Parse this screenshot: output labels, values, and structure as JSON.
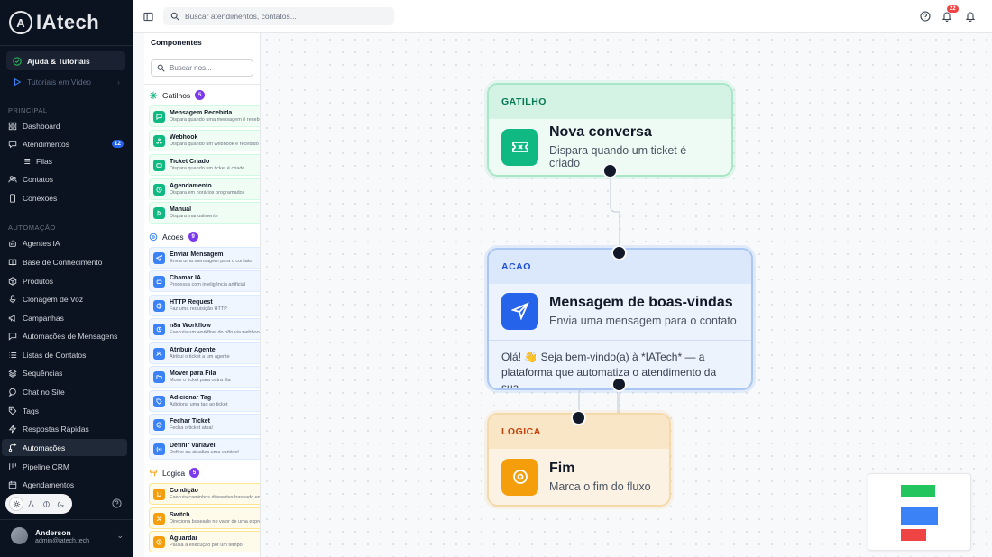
{
  "brand": {
    "logo_text": "IAtech",
    "logo_mark": "A"
  },
  "sidebar": {
    "help": {
      "label": "Ajuda & Tutoriais",
      "icon": "check-circle-icon"
    },
    "videos": {
      "label": "Tutoriais em Vídeo",
      "icon": "play-icon"
    },
    "sections": {
      "principal": "PRINCIPAL",
      "automacao": "AUTOMAÇÃO"
    },
    "items": [
      {
        "label": "Dashboard",
        "icon": "grid-icon"
      },
      {
        "label": "Atendimentos",
        "icon": "chat-icon",
        "badge": "12"
      },
      {
        "label": "Filas",
        "icon": "list-icon"
      },
      {
        "label": "Contatos",
        "icon": "users-icon"
      },
      {
        "label": "Conexões",
        "icon": "phone-icon"
      },
      {
        "label": "Agentes IA",
        "icon": "bot-icon"
      },
      {
        "label": "Base de Conhecimento",
        "icon": "book-icon"
      },
      {
        "label": "Produtos",
        "icon": "box-icon"
      },
      {
        "label": "Clonagem de Voz",
        "icon": "mic-icon"
      },
      {
        "label": "Campanhas",
        "icon": "megaphone-icon"
      },
      {
        "label": "Automações de Mensagens",
        "icon": "message-icon"
      },
      {
        "label": "Listas de Contatos",
        "icon": "list-icon"
      },
      {
        "label": "Sequências",
        "icon": "layers-icon"
      },
      {
        "label": "Chat no Site",
        "icon": "chat-icon"
      },
      {
        "label": "Tags",
        "icon": "tag-icon"
      },
      {
        "label": "Respostas Rápidas",
        "icon": "zap-icon"
      },
      {
        "label": "Automações",
        "icon": "workflow-icon",
        "active": true
      },
      {
        "label": "Pipeline CRM",
        "icon": "pipeline-icon"
      },
      {
        "label": "Agendamentos",
        "icon": "calendar-icon"
      }
    ],
    "user": {
      "name": "Anderson",
      "email": "admin@iatech.tech"
    }
  },
  "topbar": {
    "search_placeholder": "Buscar atendimentos, contatos...",
    "notifications_count": "22"
  },
  "components": {
    "title": "Componentes",
    "search_placeholder": "Buscar nos...",
    "categories": [
      {
        "name": "Gatilhos",
        "count": "5",
        "items": [
          {
            "name": "Mensagem Recebida",
            "desc": "Dispara quando uma mensagem é recebida"
          },
          {
            "name": "Webhook",
            "desc": "Dispara quando um webhook é recebido"
          },
          {
            "name": "Ticket Criado",
            "desc": "Dispara quando um ticket é criado"
          },
          {
            "name": "Agendamento",
            "desc": "Dispara em horários programados"
          },
          {
            "name": "Manual",
            "desc": "Dispara manualmente"
          }
        ]
      },
      {
        "name": "Acoes",
        "count": "9",
        "items": [
          {
            "name": "Enviar Mensagem",
            "desc": "Envia uma mensagem para o contato"
          },
          {
            "name": "Chamar IA",
            "desc": "Processa com inteligência artificial"
          },
          {
            "name": "HTTP Request",
            "desc": "Faz uma requisição HTTP"
          },
          {
            "name": "n8n Workflow",
            "desc": "Executa um workflow do n8n via webhook"
          },
          {
            "name": "Atribuir Agente",
            "desc": "Atribui o ticket a um agente"
          },
          {
            "name": "Mover para Fila",
            "desc": "Move o ticket para outra fila"
          },
          {
            "name": "Adicionar Tag",
            "desc": "Adiciona uma tag ao ticket"
          },
          {
            "name": "Fechar Ticket",
            "desc": "Fecha o ticket atual"
          },
          {
            "name": "Definir Variável",
            "desc": "Define ou atualiza uma variável"
          }
        ]
      },
      {
        "name": "Logica",
        "count": "5",
        "items": [
          {
            "name": "Condição",
            "desc": "Executa caminhos diferentes baseado em condições"
          },
          {
            "name": "Switch",
            "desc": "Direciona baseado no valor de uma expressão"
          },
          {
            "name": "Aguardar",
            "desc": "Pausa a execução por um tempo"
          }
        ]
      }
    ]
  },
  "flow": {
    "nodes": [
      {
        "type": "GATILHO",
        "title": "Nova conversa",
        "subtitle": "Dispara quando um ticket é criado",
        "color": "#10b981"
      },
      {
        "type": "ACAO",
        "title": "Mensagem de boas-vindas",
        "subtitle": "Envia uma mensagem para o contato",
        "message": "Olá! 👋 Seja bem-vindo(a) à *IATech* — a plataforma que automatiza o atendimento da sua...",
        "color": "#2563eb"
      },
      {
        "type": "LOGICA",
        "title": "Fim",
        "subtitle": "Marca o fim do fluxo",
        "color": "#f59e0b"
      }
    ]
  },
  "colors": {
    "green": "#22c55e",
    "blue": "#3b82f6",
    "red": "#ef4444",
    "sidebar_bg": "#0b1220"
  }
}
